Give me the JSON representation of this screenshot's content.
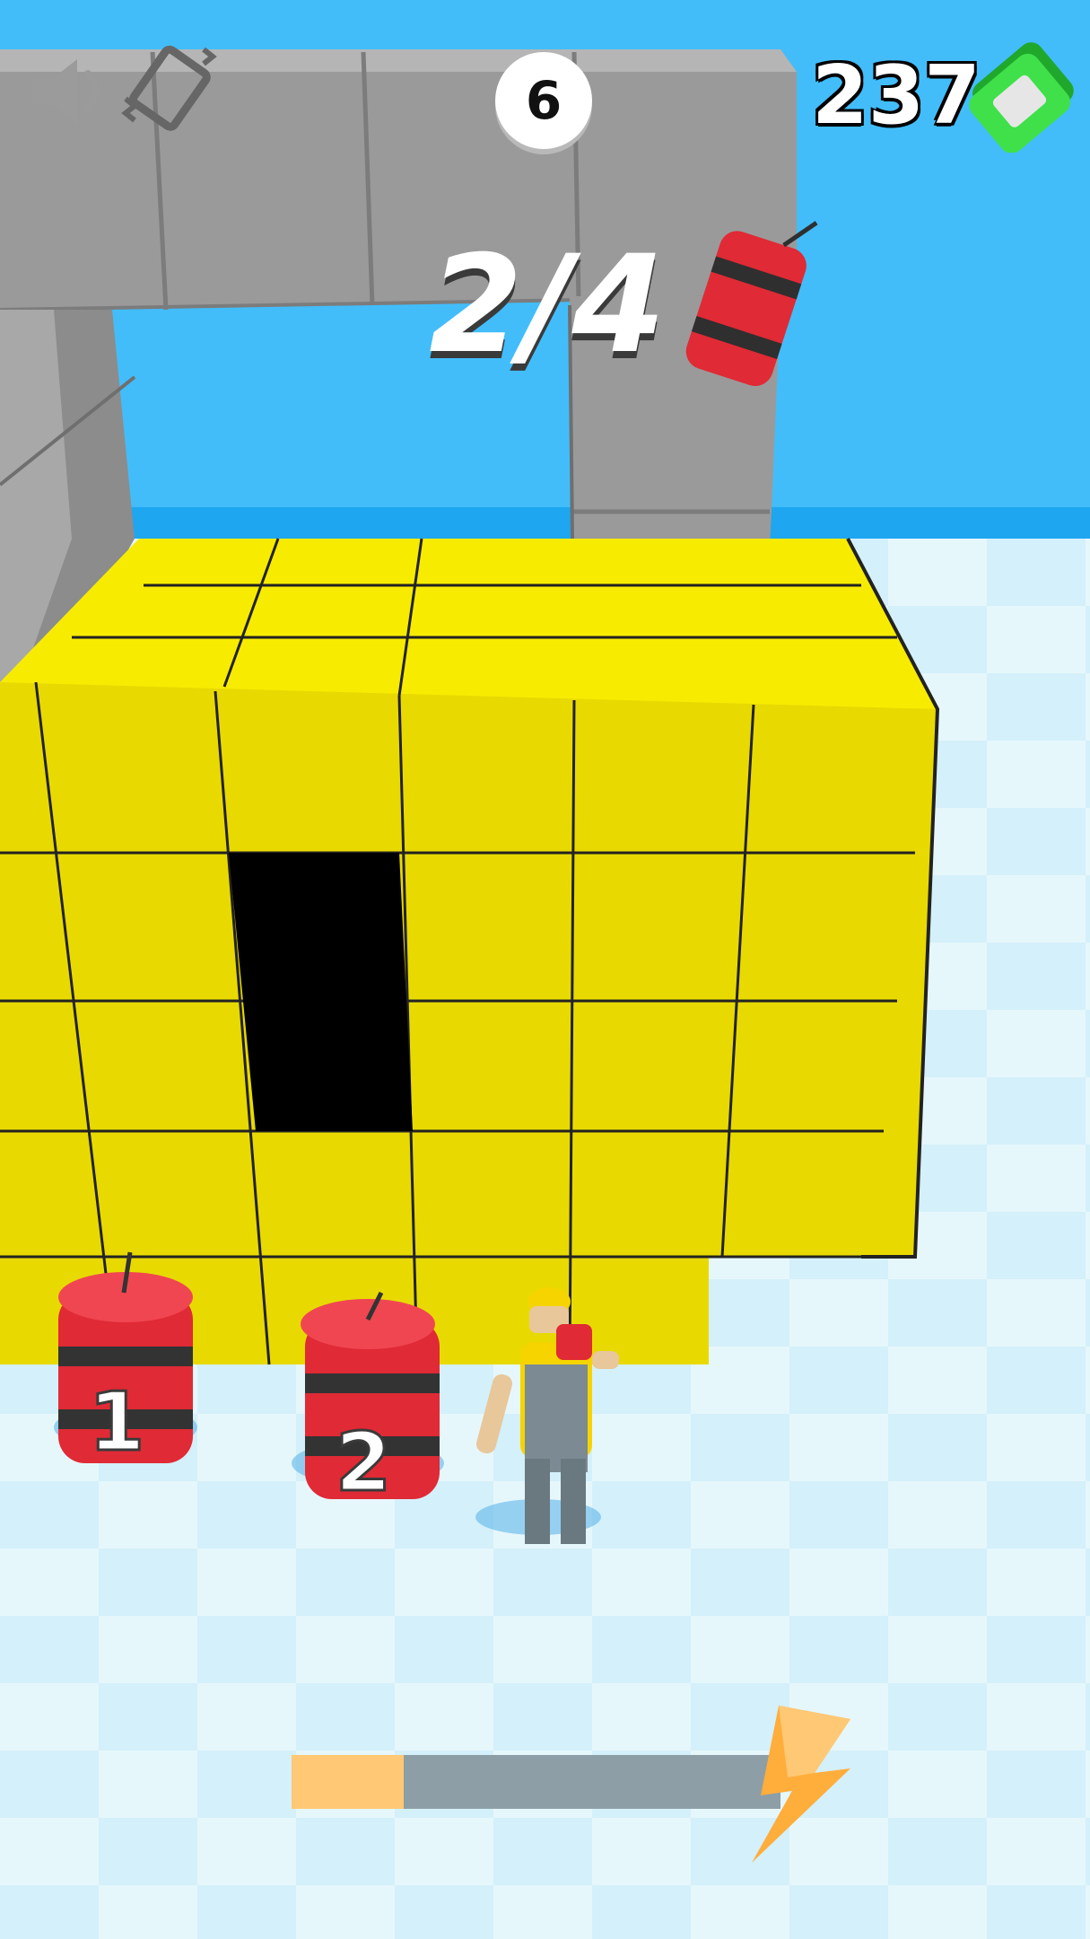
{
  "hud": {
    "level": "6",
    "cash": "237",
    "dynamite_progress": "2/4",
    "power_fraction": 0.23
  },
  "icons": {
    "sound": "speaker-icon",
    "vibration": "phone-vibrate-icon",
    "cash": "cash-bill-icon",
    "dynamite": "dynamite-icon",
    "boost": "lightning-bolt-icon"
  },
  "dynamite_stacks": [
    {
      "label": "1"
    },
    {
      "label": "2"
    }
  ],
  "colors": {
    "sky": "#42bdfa",
    "wall_yellow": "#e8da00",
    "wall_gray": "#9a9a9a",
    "floor": "#e6f7fc",
    "dynamite_red": "#e02a35",
    "progress_fill": "#ffc874",
    "progress_track": "#8d9ea6"
  }
}
